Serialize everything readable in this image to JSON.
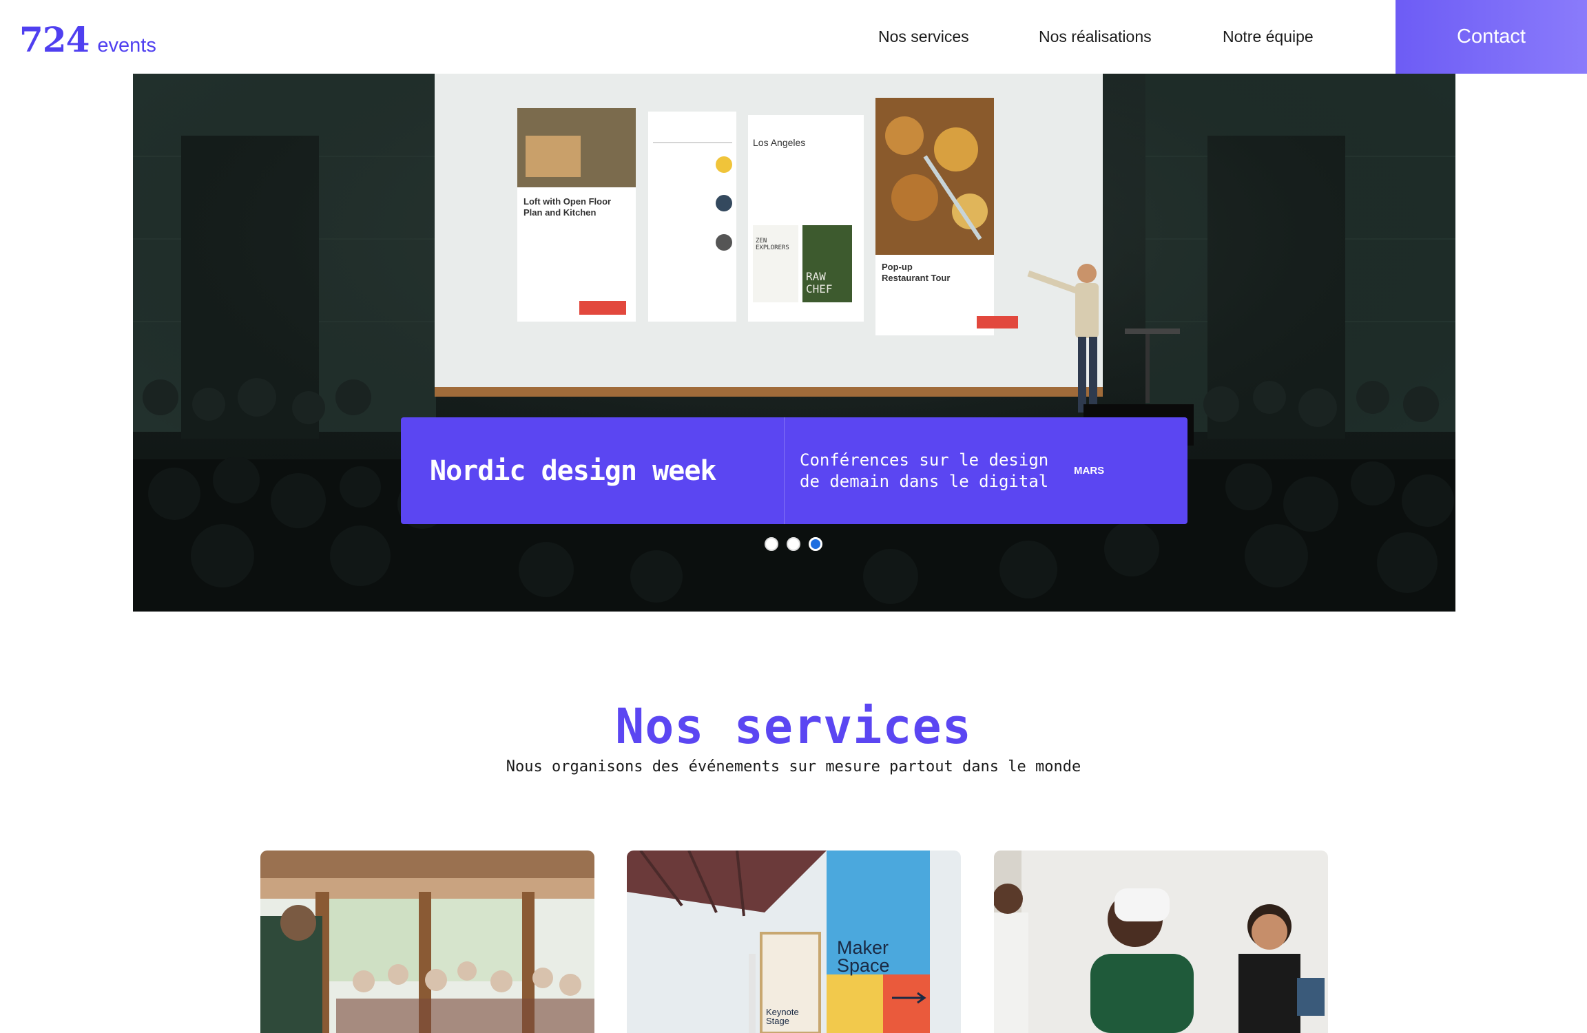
{
  "header": {
    "logo_number": "724",
    "logo_word": "events",
    "nav": [
      {
        "label": "Nos services"
      },
      {
        "label": "Nos réalisations"
      },
      {
        "label": "Notre équipe"
      }
    ],
    "contact_label": "Contact"
  },
  "hero": {
    "caption": {
      "title": "Nordic design week",
      "description": "Conférences sur le design de demain dans le digital",
      "month": "MARS"
    },
    "slides_total": 3,
    "active_slide": 3,
    "screen_cards": {
      "card1_title": "Loft with Open Floor Plan and Kitchen",
      "card3_title": "Los Angeles",
      "card3_book1": "ZEN EXPLORERS",
      "card3_book2": "RAW CHEF",
      "card4_title": "Pop-up Restaurant Tour"
    }
  },
  "services": {
    "title": "Nos services",
    "subtitle": "Nous organisons des événements sur mesure partout dans le monde",
    "cards": [
      {
        "alt": "restaurant-event-photo"
      },
      {
        "alt": "maker-space-photo",
        "sign_main": "Maker Space",
        "sign_small": "Keynote Stage"
      },
      {
        "alt": "vr-headset-photo"
      }
    ]
  },
  "colors": {
    "brand": "#5b46f2",
    "contact_gradient_start": "#6d5cf5",
    "contact_gradient_end": "#8a7bfb",
    "active_dot": "#1f6fe0"
  }
}
